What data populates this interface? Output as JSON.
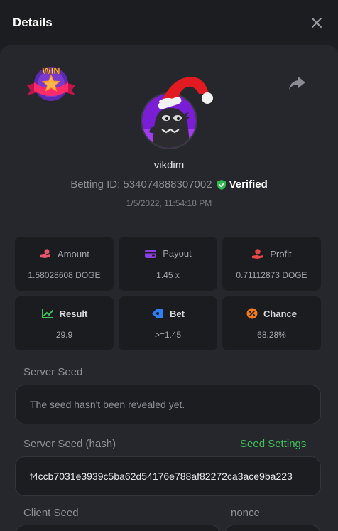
{
  "header": {
    "title": "Details"
  },
  "badge": {
    "text": "WIN"
  },
  "user": {
    "name": "vikdim",
    "betting_id": "Betting ID: 534074888307002",
    "verified_label": "Verified",
    "datetime": "1/5/2022, 11:54:18 PM"
  },
  "stats": [
    {
      "label": "Amount",
      "value": "1.58028608 DOGE",
      "icon": "hand-coins-icon",
      "color": "#e8566a"
    },
    {
      "label": "Payout",
      "value": "1.45 x",
      "icon": "wallet-icon",
      "color": "#8b3fe0"
    },
    {
      "label": "Profit",
      "value": "0.71112873 DOGE",
      "icon": "profit-hand-icon",
      "color": "#e84545"
    },
    {
      "label": "Result",
      "value": "29.9",
      "icon": "result-chart-icon",
      "color": "#3ec45a"
    },
    {
      "label": "Bet",
      "value": ">=1.45",
      "icon": "bet-tag-icon",
      "color": "#2f7ef5"
    },
    {
      "label": "Chance",
      "value": "68.28%",
      "icon": "percent-icon",
      "color": "#f07a1c"
    }
  ],
  "server_seed": {
    "label": "Server Seed",
    "value": "The seed hasn't been revealed yet."
  },
  "server_seed_hash": {
    "label": "Server Seed (hash)",
    "value": "f4ccb7031e3939c5ba62d54176e788af82272ca3ace9ba223",
    "settings_link": "Seed Settings"
  },
  "client_seed": {
    "label": "Client Seed"
  },
  "nonce": {
    "label": "nonce"
  }
}
